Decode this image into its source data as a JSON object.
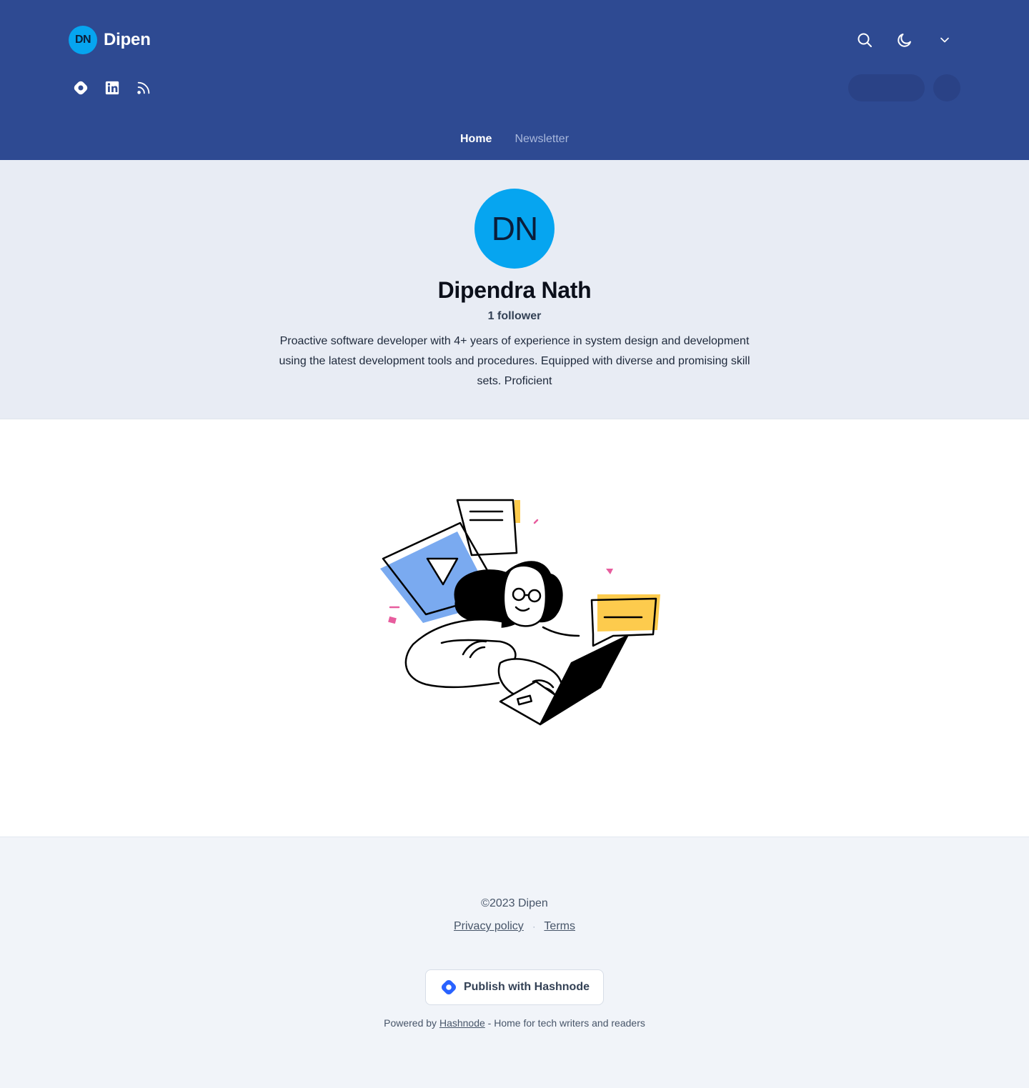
{
  "header": {
    "brand_initials": "DN",
    "brand_name": "Dipen",
    "tools": [
      {
        "icon": "search-icon"
      },
      {
        "icon": "moon-icon"
      },
      {
        "icon": "chevron-down-icon"
      }
    ],
    "social": [
      {
        "icon": "hashnode-icon"
      },
      {
        "icon": "linkedin-icon"
      },
      {
        "icon": "rss-icon"
      }
    ],
    "nav": [
      {
        "label": "Home",
        "active": true
      },
      {
        "label": "Newsletter",
        "active": false
      }
    ]
  },
  "profile": {
    "initials": "DN",
    "name": "Dipendra Nath",
    "followers": "1 follower",
    "bio": "Proactive software developer with 4+ years of experience in system design and development using the latest development tools and procedures. Equipped with diverse and promising skill sets. Proficient"
  },
  "footer": {
    "copyright": "©2023 Dipen",
    "privacy": "Privacy policy",
    "separator": "·",
    "terms": "Terms",
    "publish": "Publish with Hashnode",
    "powered_prefix": "Powered by",
    "powered_link": "Hashnode",
    "powered_suffix": "- Home for tech writers and readers"
  },
  "colors": {
    "header_bg": "#2e4a92",
    "avatar_bg": "#06a5f0",
    "hashnode_blue": "#2962ff"
  }
}
